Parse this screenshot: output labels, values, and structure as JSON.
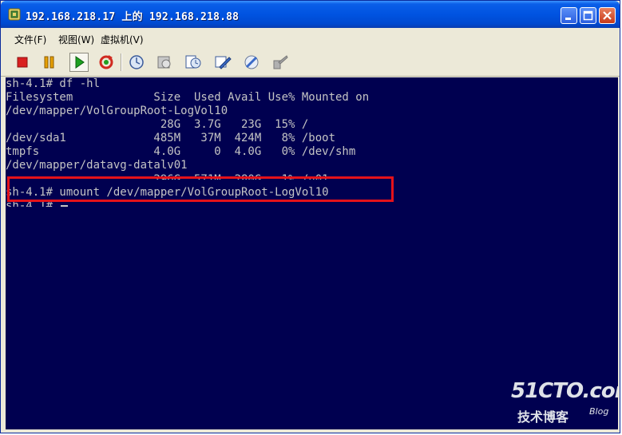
{
  "window": {
    "title": "192.168.218.17 上的 192.168.218.88"
  },
  "menu": {
    "items": [
      {
        "label": "文件(F)"
      },
      {
        "label": "视图(W)"
      },
      {
        "label": "虚拟机(V)"
      }
    ]
  },
  "toolbar": {
    "buttons": [
      {
        "icon": "stop-icon",
        "color": "#d92020"
      },
      {
        "icon": "pause-icon",
        "color": "#e6a000"
      },
      {
        "icon": "play-icon",
        "color": "#1ea020"
      },
      {
        "icon": "reset-icon",
        "color": "#d02a20"
      },
      {
        "icon": "snapshot-icon"
      },
      {
        "icon": "revert-snapshot-icon"
      },
      {
        "icon": "manage-snapshots-icon"
      },
      {
        "icon": "settings-icon"
      },
      {
        "icon": "tools-icon"
      },
      {
        "icon": "console-icon"
      }
    ]
  },
  "terminal": {
    "lines": [
      "sh-4.1# df -hl",
      "Filesystem            Size  Used Avail Use% Mounted on",
      "/dev/mapper/VolGroupRoot-LogVol10",
      "                       28G  3.7G   23G  15% /",
      "/dev/sda1             485M   37M  424M   8% /boot",
      "tmpfs                 4.0G     0  4.0G   0% /dev/shm",
      "/dev/mapper/datavg-datalv01",
      "                      296G  571M  280G   1% /u01",
      "sh-4.1# umount /dev/mapper/VolGroupRoot-LogVol10",
      "sh-4.1# "
    ],
    "bg_color": "#000050",
    "text_color": "#c4c4c4"
  },
  "annotation": {
    "color": "#e4121a"
  },
  "watermark": {
    "main": "51CTO.com",
    "sub": "技术博客",
    "blog": "Blog"
  }
}
